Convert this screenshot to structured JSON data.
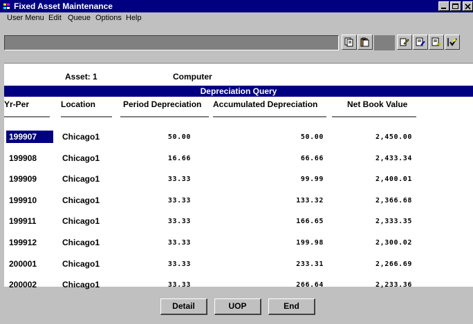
{
  "window": {
    "title": "Fixed Asset Maintenance"
  },
  "menu": {
    "items": [
      "User Menu",
      "Edit",
      "Queue",
      "Options",
      "Help"
    ]
  },
  "asset": {
    "label": "Asset:  1",
    "description": "Computer"
  },
  "query": {
    "title": "Depreciation Query",
    "columns": [
      "Yr-Per",
      "Location",
      "Period Depreciation",
      "Accumulated Depreciation",
      "Net Book Value"
    ],
    "rows": [
      {
        "period": "199907",
        "location": "Chicago1",
        "period_dep": "50.00",
        "accum_dep": "50.00",
        "nbv": "2,450.00",
        "selected": true
      },
      {
        "period": "199908",
        "location": "Chicago1",
        "period_dep": "16.66",
        "accum_dep": "66.66",
        "nbv": "2,433.34",
        "selected": false
      },
      {
        "period": "199909",
        "location": "Chicago1",
        "period_dep": "33.33",
        "accum_dep": "99.99",
        "nbv": "2,400.01",
        "selected": false
      },
      {
        "period": "199910",
        "location": "Chicago1",
        "period_dep": "33.33",
        "accum_dep": "133.32",
        "nbv": "2,366.68",
        "selected": false
      },
      {
        "period": "199911",
        "location": "Chicago1",
        "period_dep": "33.33",
        "accum_dep": "166.65",
        "nbv": "2,333.35",
        "selected": false
      },
      {
        "period": "199912",
        "location": "Chicago1",
        "period_dep": "33.33",
        "accum_dep": "199.98",
        "nbv": "2,300.02",
        "selected": false
      },
      {
        "period": "200001",
        "location": "Chicago1",
        "period_dep": "33.33",
        "accum_dep": "233.31",
        "nbv": "2,266.69",
        "selected": false
      },
      {
        "period": "200002",
        "location": "Chicago1",
        "period_dep": "33.33",
        "accum_dep": "266.64",
        "nbv": "2,233.36",
        "selected": false
      }
    ]
  },
  "buttons": {
    "detail": "Detail",
    "uop": "UOP",
    "end": "End"
  },
  "icons": [
    "copy-icon",
    "paste-icon",
    "query-icon",
    "edit-document-icon",
    "export-document-icon",
    "checkmark-pencil-icon"
  ],
  "colors": {
    "title_bar": "#000080",
    "window_bg": "#c0c0c0",
    "selection": "#000080"
  }
}
